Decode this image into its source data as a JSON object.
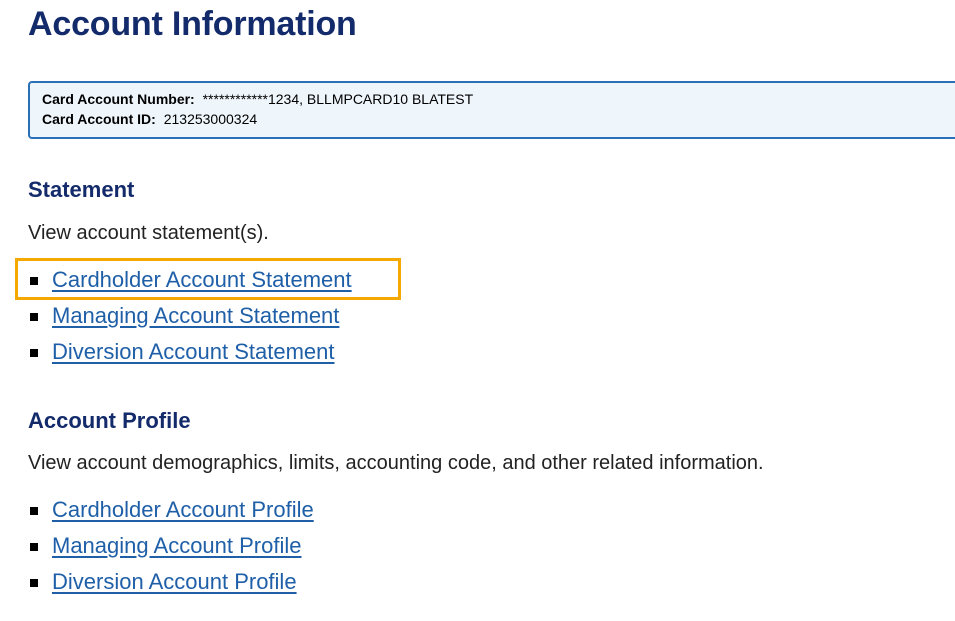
{
  "page": {
    "title": "Account Information"
  },
  "account": {
    "number_label": "Card Account Number:",
    "number_value": "************1234, BLLMPCARD10 BLATEST",
    "id_label": "Card Account ID:",
    "id_value": "213253000324"
  },
  "statement": {
    "heading": "Statement",
    "description": "View account statement(s).",
    "links": [
      "Cardholder Account Statement",
      "Managing Account Statement",
      "Diversion Account Statement"
    ]
  },
  "profile": {
    "heading": "Account Profile",
    "description": "View account demographics, limits, accounting code, and other related information.",
    "links": [
      "Cardholder Account Profile",
      "Managing Account Profile",
      "Diversion Account Profile"
    ]
  },
  "colors": {
    "heading": "#132a6b",
    "link": "#1f5fa8",
    "box_border": "#2b6fb6",
    "box_background": "#eef5fb",
    "highlight": "#f5a800"
  }
}
